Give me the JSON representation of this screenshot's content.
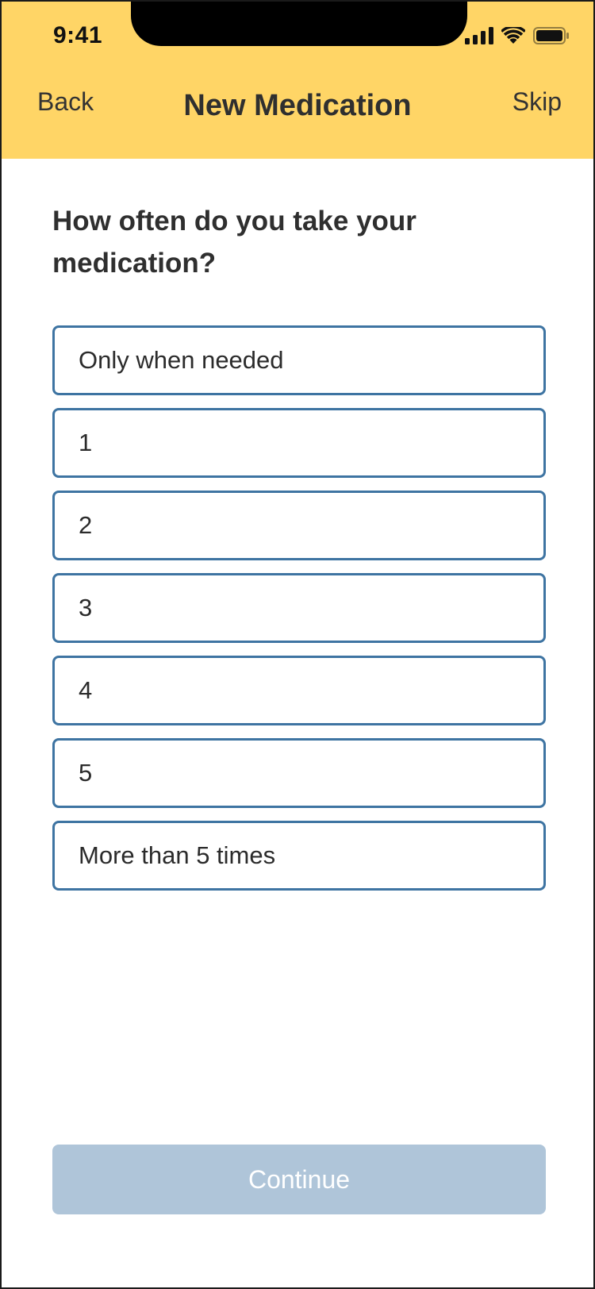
{
  "status_bar": {
    "time": "9:41",
    "icons": [
      "cellular-signal-icon",
      "wifi-icon",
      "battery-icon"
    ]
  },
  "nav": {
    "back_label": "Back",
    "title": "New Medication",
    "skip_label": "Skip"
  },
  "question": "How often do you take your medication?",
  "options": [
    "Only when needed",
    "1",
    "2",
    "3",
    "4",
    "5",
    "More than 5 times"
  ],
  "continue_label": "Continue",
  "colors": {
    "header_bg": "#FFD566",
    "option_border": "#3E74A2",
    "continue_disabled_bg": "#AFC5D9"
  }
}
